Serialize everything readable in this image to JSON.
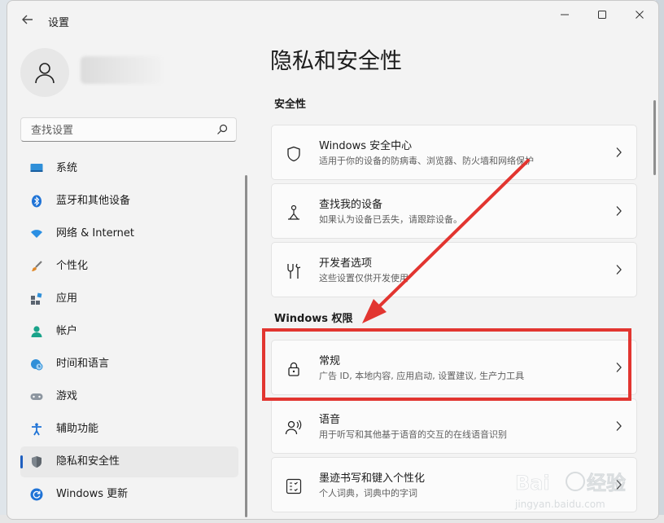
{
  "window": {
    "title": "设置",
    "back_icon": "back-arrow-icon",
    "controls": [
      "minimize-icon",
      "maximize-icon",
      "close-icon"
    ]
  },
  "sidebar": {
    "search_placeholder": "查找设置",
    "items": [
      {
        "label": "系统",
        "icon": "system-display-icon",
        "selected": false
      },
      {
        "label": "蓝牙和其他设备",
        "icon": "bluetooth-icon",
        "selected": false
      },
      {
        "label": "网络 & Internet",
        "icon": "wifi-icon",
        "selected": false
      },
      {
        "label": "个性化",
        "icon": "brush-icon",
        "selected": false
      },
      {
        "label": "应用",
        "icon": "apps-icon",
        "selected": false
      },
      {
        "label": "帐户",
        "icon": "account-icon",
        "selected": false
      },
      {
        "label": "时间和语言",
        "icon": "time-language-icon",
        "selected": false
      },
      {
        "label": "游戏",
        "icon": "gamepad-icon",
        "selected": false
      },
      {
        "label": "辅助功能",
        "icon": "accessibility-icon",
        "selected": false
      },
      {
        "label": "隐私和安全性",
        "icon": "shield-icon",
        "selected": true
      },
      {
        "label": "Windows 更新",
        "icon": "update-icon",
        "selected": false
      }
    ]
  },
  "main": {
    "title": "隐私和安全性",
    "sections": [
      {
        "title": "安全性",
        "cards": [
          {
            "title": "Windows 安全中心",
            "subtitle": "适用于你的设备的防病毒、浏览器、防火墙和网络保护",
            "icon": "shield-outline-icon"
          },
          {
            "title": "查找我的设备",
            "subtitle": "如果认为设备已丢失，请跟踪设备。",
            "icon": "find-device-icon"
          },
          {
            "title": "开发者选项",
            "subtitle": "这些设置仅供开发使用",
            "icon": "developer-tools-icon"
          }
        ]
      },
      {
        "title": "Windows 权限",
        "cards": [
          {
            "title": "常规",
            "subtitle": "广告 ID, 本地内容, 应用启动, 设置建议, 生产力工具",
            "icon": "lock-icon"
          },
          {
            "title": "语音",
            "subtitle": "用于听写和其他基于语音的交互的在线语音识别",
            "icon": "speech-icon"
          },
          {
            "title": "墨迹书写和键入个性化",
            "subtitle": "个人词典，词典中的字词",
            "icon": "handwriting-icon"
          }
        ]
      }
    ]
  },
  "colors": {
    "accent": "#1f5fbf",
    "annotation_red": "#e23530"
  }
}
